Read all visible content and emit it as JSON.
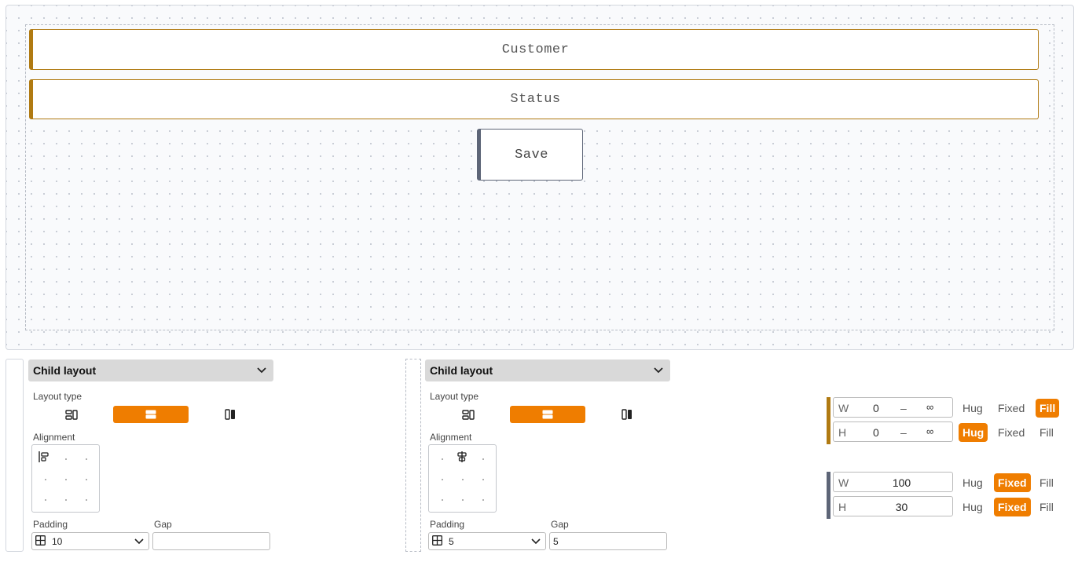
{
  "canvas": {
    "fields": [
      "Customer",
      "Status"
    ],
    "button_label": "Save"
  },
  "panels": [
    {
      "title": "Child layout",
      "layout_type_label": "Layout type",
      "layout_types": [
        "stack-vertical-icon",
        "rows-icon",
        "columns-icon"
      ],
      "selected_layout_type": 1,
      "alignment_label": "Alignment",
      "alignment_selected": "top-left",
      "padding_label": "Padding",
      "padding_value": "10",
      "gap_label": "Gap",
      "gap_value": ""
    },
    {
      "title": "Child layout",
      "layout_type_label": "Layout type",
      "layout_types": [
        "stack-vertical-icon",
        "rows-icon",
        "columns-icon"
      ],
      "selected_layout_type": 1,
      "alignment_label": "Alignment",
      "alignment_selected": "top-center",
      "padding_label": "Padding",
      "padding_value": "5",
      "gap_label": "Gap",
      "gap_value": "5"
    }
  ],
  "sizing": [
    {
      "accent": "#b07a12",
      "rows": [
        {
          "axis": "W",
          "min": "0",
          "sep": "–",
          "max": "∞",
          "options": [
            "Hug",
            "Fixed",
            "Fill"
          ],
          "selected": "Fill"
        },
        {
          "axis": "H",
          "min": "0",
          "sep": "–",
          "max": "∞",
          "options": [
            "Hug",
            "Fixed",
            "Fill"
          ],
          "selected": "Hug"
        }
      ]
    },
    {
      "accent": "#5d6577",
      "rows": [
        {
          "axis": "W",
          "value": "100",
          "options": [
            "Hug",
            "Fixed",
            "Fill"
          ],
          "selected": "Fixed"
        },
        {
          "axis": "H",
          "value": "30",
          "options": [
            "Hug",
            "Fixed",
            "Fill"
          ],
          "selected": "Fixed"
        }
      ]
    }
  ],
  "colors": {
    "accent": "#ef7d00",
    "field_border": "#b07a12",
    "button_border": "#5d6577"
  }
}
